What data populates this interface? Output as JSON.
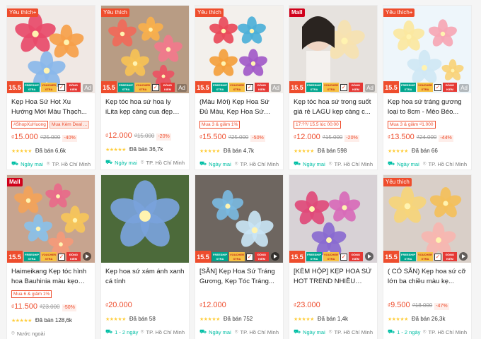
{
  "products": [
    {
      "badge": "Yêu thích+",
      "badge_type": "fav",
      "title": "Kẹp Hoa Sứ Hot Xu Hướng Mới Màu Thạch...",
      "tags": [
        "#ShopXuHuong",
        "Mua Kèm Deal ..."
      ],
      "price_cur": "₫",
      "price": "15.000",
      "old_price": "₫25.000",
      "discount": "-40%",
      "sold": "Đã bán 6,6k",
      "ship": "Ngày mai",
      "location": "TP. Hồ Chí Minh",
      "promo": "15.5",
      "corner": "Ad",
      "colors": [
        "#e84a6a",
        "#f6a04a",
        "#8ab7ea",
        "#f7d08a",
        "#3aa0d8"
      ],
      "bg": "#f0e8e4"
    },
    {
      "badge": "Yêu thích",
      "badge_type": "fav",
      "title": "Kẹp tóc hoa sứ hoa ly iLita kẹp càng cua đẹp cho n...",
      "tags": [],
      "price_cur": "₫",
      "price": "12.000",
      "old_price": "₫15.000",
      "discount": "-20%",
      "sold": "Đã bán 36,7k",
      "ship": "Ngày mai",
      "location": "TP. Hồ Chí Minh",
      "promo": "15.5",
      "corner": "Ad",
      "colors": [
        "#f06a5a",
        "#f8b04c",
        "#f17a8c",
        "#f6c255",
        "#ea5464"
      ],
      "bg": "#b89c84"
    },
    {
      "badge": "Yêu thích",
      "badge_type": "fav",
      "title": "(Màu Mới) Kẹp Hoa Sứ Đủ Màu, Kẹp Hoa Sứ Trắng...",
      "tags": [
        "Mua 3 & giảm 1%"
      ],
      "price_cur": "₫",
      "price": "15.500",
      "old_price": "₫25.000",
      "discount": "-50%",
      "sold": "Đã bán 4,7k",
      "ship": "Ngày mai",
      "location": "TP. Hồ Chí Minh",
      "promo": "15.5",
      "corner": "Ad",
      "colors": [
        "#e94a5a",
        "#4cb0d8",
        "#f4a03c",
        "#a25ac8",
        "#5ab87a"
      ],
      "bg": "#f3f0ec"
    },
    {
      "badge": "Mall",
      "badge_type": "mall",
      "title": "Kẹp tóc hoa sứ trong suốt giá rẻ LAGU kẹp càng c...",
      "tags": [
        "17:??/ 15.5 lúc 00:00"
      ],
      "price_cur": "₫",
      "price": "12.000",
      "old_price": "₫15.000",
      "discount": "-20%",
      "sold": "Đã bán 598",
      "ship": "Ngày mai",
      "location": "TP. Hồ Chí Minh",
      "promo": "15.5",
      "corner": "Ad",
      "colors": [
        "#f6e2b0",
        "#f3d596",
        "#f7e8c4",
        "#eed7a0",
        "#f0dca8"
      ],
      "bg": "#e6e2de"
    },
    {
      "badge": "Yêu thích+",
      "badge_type": "fav",
      "title": "Kẹp hoa sứ tráng gương loại to 8cm - Mèo Béo...",
      "tags": [
        "Mua 3 & giảm ₫1.000"
      ],
      "price_cur": "₫",
      "price": "13.500",
      "old_price": "₫24.000",
      "discount": "-44%",
      "sold": "Đã bán 66",
      "ship": "Ngày mai",
      "location": "TP. Hồ Chí Minh",
      "promo": "15.5",
      "corner": "Ad",
      "colors": [
        "#fbe7a0",
        "#f6a6b4",
        "#cfe7f4",
        "#f9d27a",
        "#e8f1d0"
      ],
      "bg": "#eef6fb"
    },
    {
      "badge": "Mall",
      "badge_type": "mall",
      "title": "Haimeikang Kẹp tóc hình hoa Bauhinia màu kẹo th...",
      "tags": [
        "Mua 6 & giảm 1%"
      ],
      "price_cur": "₫",
      "price": "11.500",
      "old_price": "₫23.000",
      "discount": "-50%",
      "sold": "Đã bán 128,6k",
      "ship": "Nước ngoài",
      "location": "",
      "promo": "15.5",
      "corner": "play",
      "colors": [
        "#f2a35a",
        "#e86a8a",
        "#f6c65a",
        "#8ac0e8",
        "#f49a7a"
      ],
      "bg": "#c7a48f"
    },
    {
      "badge": "",
      "badge_type": "",
      "title": "Kẹp hoa sứ xám ánh xanh cá tính",
      "tags": [],
      "price_cur": "₫",
      "price": "20.000",
      "old_price": "",
      "discount": "",
      "sold": "Đã bán 58",
      "ship": "1 - 2 ngày",
      "location": "TP. Hồ Chí Minh",
      "promo": "",
      "corner": "",
      "colors": [
        "#7aa3dc",
        "#5b86c8",
        "#8fb2e4",
        "#6c94d2",
        "#4a76bd"
      ],
      "bg": "#4c6a3a"
    },
    {
      "badge": "",
      "badge_type": "",
      "title": "[SẴN] Kẹp Hoa Sứ Tráng Gương, Kẹp Tóc Tráng...",
      "tags": [],
      "price_cur": "₫",
      "price": "12.000",
      "old_price": "",
      "discount": "",
      "sold": "Đã bán 752",
      "ship": "Ngày mai",
      "location": "TP. Hồ Chí Minh",
      "promo": "15.5",
      "corner": "play",
      "colors": [
        "#7ab8e0",
        "#c8e4f4",
        "#5aa8d4",
        "#a8d2ec",
        "#3f8fc4"
      ],
      "bg": "#6e6660"
    },
    {
      "badge": "",
      "badge_type": "",
      "title": "[KÈM HỘP] KẸP HOA SỨ HOT TREND NHIỀU MÀ...",
      "tags": [],
      "price_cur": "₫",
      "price": "23.000",
      "old_price": "",
      "discount": "",
      "sold": "Đã bán 1,4k",
      "ship": "Ngày mai",
      "location": "TP. Hồ Chí Minh",
      "promo": "15.5",
      "corner": "play",
      "colors": [
        "#e04a7a",
        "#d86ab8",
        "#8a6ad0",
        "#f08aa0",
        "#c05a9a"
      ],
      "bg": "#d8d2d6"
    },
    {
      "badge": "Yêu thích",
      "badge_type": "fav",
      "title": "( CÓ SẴN) Kẹp hoa sứ cỡ lớn ba chiều màu kẹ...",
      "tags": [],
      "price_cur": "₫",
      "price": "9.500",
      "old_price": "₫18.000",
      "discount": "-47%",
      "sold": "Đã bán 26,3k",
      "ship": "1 - 2 ngày",
      "location": "TP. Hồ Chí Minh",
      "promo": "15.5",
      "corner": "play",
      "colors": [
        "#f6d57a",
        "#f4c05a",
        "#f7b6b0",
        "#f2ddb2",
        "#f08a6a"
      ],
      "bg": "#d9cfc8"
    }
  ],
  "promo_badges": {
    "freeship": "FREESHIP XTRA",
    "voucher": "VOUCHER XTRA",
    "hoan": "ĐỒNG KIỂM"
  }
}
